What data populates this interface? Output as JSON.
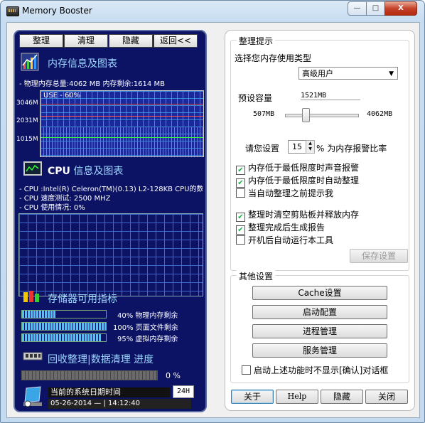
{
  "window": {
    "title": "Memory Booster",
    "minimize": "—",
    "maximize": "□",
    "close": "X"
  },
  "left": {
    "buttons": {
      "clean": "整理",
      "clear": "清理",
      "hide": "隐藏",
      "back": "返回<<"
    },
    "memory": {
      "title": "内存信息及图表",
      "summary": "- 物理内存总量:4062 MB  内存剩余:1614 MB",
      "use_label": "USE - 60%",
      "y_ticks": [
        "3046M",
        "2031M",
        "1015M"
      ]
    },
    "cpu": {
      "title_bold": "CPU",
      "title_rest": " 信息及图表",
      "info": "- CPU :Intel(R) Celeron(TM)(0.13) L2-128KB CPU的数",
      "speed": "- CPU 速度测试: 2500 MHZ",
      "usage": "- CPU 使用情况:  0%"
    },
    "storage": {
      "title": "存储器可用指标",
      "bars": [
        {
          "pct": "40%",
          "label": "物理内存剩余",
          "fill": 0.4
        },
        {
          "pct": "100%",
          "label": "页面文件剩余",
          "fill": 1.0
        },
        {
          "pct": "95%",
          "label": "虚拟内存剩余",
          "fill": 0.95
        }
      ]
    },
    "recycle": {
      "title": "回收整理|数据清理 进度",
      "pct": "0 %"
    },
    "date": {
      "label": "当前的系统日期时间",
      "value": "05-26-2014  — | 14:12:40",
      "mode": "24H"
    }
  },
  "right": {
    "tips": {
      "title": "整理提示",
      "choose_type": "选择您内存使用类型",
      "type_value": "高级用户",
      "preset_label": "预设容量",
      "preset_value": "1521MB",
      "min": "507MB",
      "max": "4062MB",
      "set_prefix": "请您设置",
      "set_value": "15",
      "set_suffix": "% 为内存报警比率",
      "save": "保存设置"
    },
    "checks": [
      {
        "label": "内存低于最低限度时声音报警",
        "checked": true
      },
      {
        "label": "内存低于最低限度时自动整理",
        "checked": true
      },
      {
        "label": "当自动整理之前提示我",
        "checked": false
      },
      {
        "label": "整理时清空剪贴板并释放内存",
        "checked": true
      },
      {
        "label": "整理完成后生成报告",
        "checked": true
      },
      {
        "label": "开机后自动运行本工具",
        "checked": false
      }
    ],
    "other": {
      "title": "其他设置",
      "buttons": [
        "Cache设置",
        "启动配置",
        "进程管理",
        "服务管理"
      ],
      "nodialog": "启动上述功能时不显示[确认]对话框"
    },
    "bottom": {
      "about": "关于",
      "help": "Help",
      "hide": "隐藏",
      "close": "关闭"
    }
  }
}
